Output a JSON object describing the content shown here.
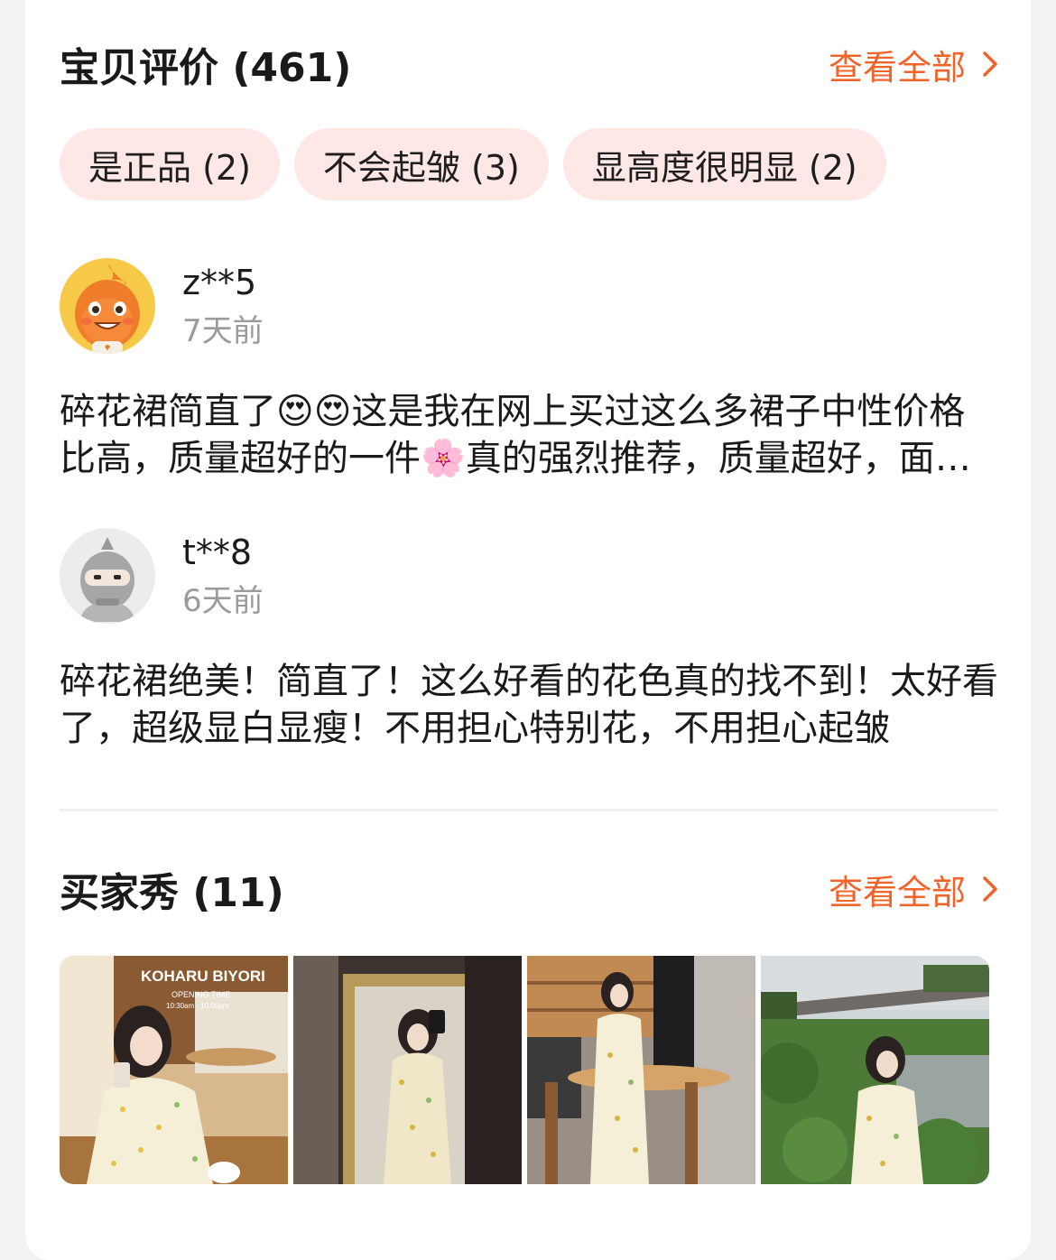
{
  "reviews_section": {
    "title": "宝贝评价 (461)",
    "view_all": "查看全部"
  },
  "tags": [
    {
      "label": "是正品 (2)"
    },
    {
      "label": "不会起皱 (3)"
    },
    {
      "label": "显高度很明显 (2)"
    }
  ],
  "reviews": [
    {
      "user": "z**5",
      "time": "7天前",
      "text": "碎花裙简直了😍😍这是我在网上买过这么多裙子中性价格比高，质量超好的一件🌸真的强烈推荐，质量超好，面料舒服",
      "avatar_icon": "orange-mascot-avatar-icon"
    },
    {
      "user": "t**8",
      "time": "6天前",
      "text": "碎花裙绝美！简直了！这么好看的花色真的找不到！太好看了，超级显白显瘦！不用担心特别花，不用担心起皱",
      "avatar_icon": "gray-ninja-avatar-icon"
    }
  ],
  "buyer_show": {
    "title": "买家秀 (11)",
    "view_all": "查看全部",
    "photo1_sign": "KOHARU BIYORI",
    "photo1_sign_sub": "OPENING TIME",
    "photo1_sign_hours": "10:30am - 10:00pm"
  },
  "colors": {
    "accent": "#f0642a",
    "tag_bg": "#fde8e6",
    "time_gray": "#9b9b9b"
  }
}
